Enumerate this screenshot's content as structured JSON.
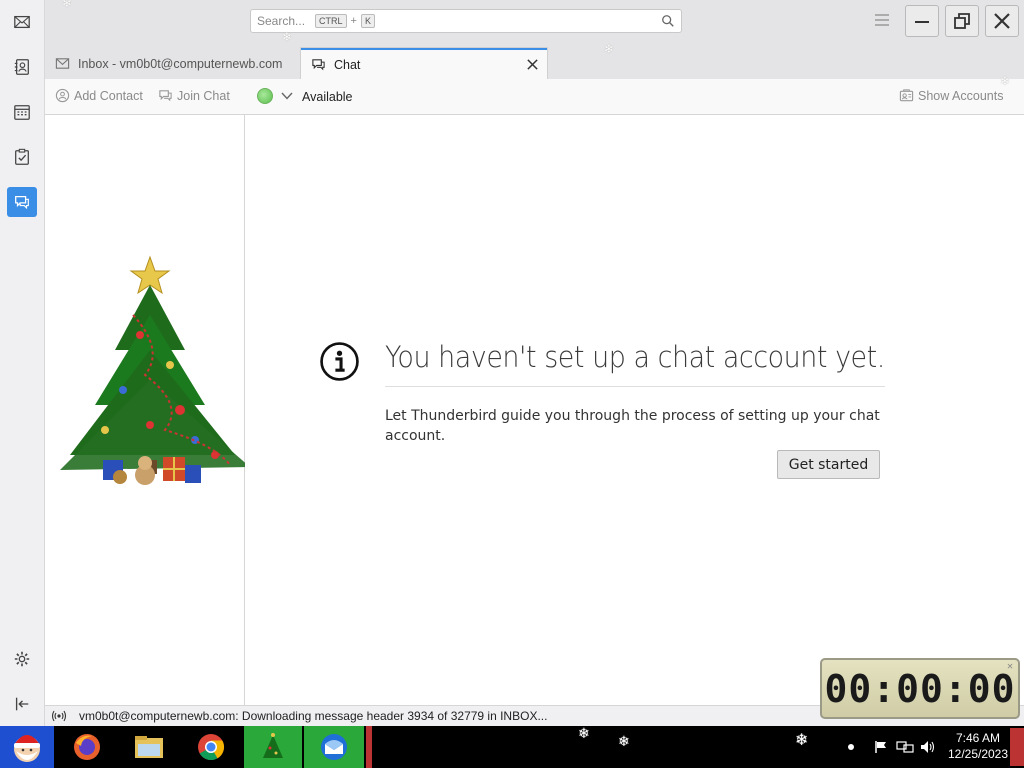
{
  "search": {
    "placeholder": "Search...",
    "kbd_ctrl": "CTRL",
    "kbd_plus": "+",
    "kbd_k": "K"
  },
  "tabs": [
    {
      "label": "Inbox - vm0b0t@computernewb.com"
    },
    {
      "label": "Chat"
    }
  ],
  "chat_toolbar": {
    "add_contact": "Add Contact",
    "join_chat": "Join Chat",
    "status": "Available",
    "show_accounts": "Show Accounts"
  },
  "main": {
    "heading": "You haven't set up a chat account yet.",
    "description": "Let Thunderbird guide you through the process of setting up your chat account.",
    "button": "Get started"
  },
  "statusbar": {
    "message": "vm0b0t@computernewb.com: Downloading message header 3934 of 32779 in INBOX..."
  },
  "timer": {
    "value": "00:00:00"
  },
  "taskbar": {
    "time": "7:46 AM",
    "date": "12/25/2023"
  },
  "colors": {
    "accent": "#3a8ee6",
    "status_available": "#5bbf4c"
  }
}
